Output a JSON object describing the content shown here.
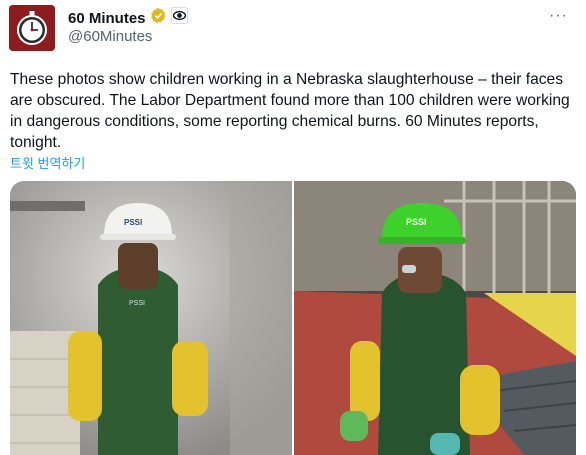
{
  "account": {
    "display_name": "60 Minutes",
    "handle": "@60Minutes",
    "avatar_icon": "stopwatch-logo-icon",
    "verified_icon": "gold-verified-badge-icon",
    "affiliate_icon": "cbs-eye-icon"
  },
  "tweet": {
    "text": "These photos show children working in a Nebraska slaughterhouse – their faces are obscured. The Labor Department found more than 100 children were working in dangerous conditions, some reporting chemical burns. 60 Minutes reports, tonight.",
    "translate_label": "트윗 번역하기",
    "more_label": "···"
  },
  "media": {
    "left_helmet_text": "PSSI",
    "right_helmet_text": "PSSI"
  },
  "colors": {
    "link": "#1d9bf0",
    "secondary_text": "#536471",
    "verified_gold": "#e2b719"
  }
}
